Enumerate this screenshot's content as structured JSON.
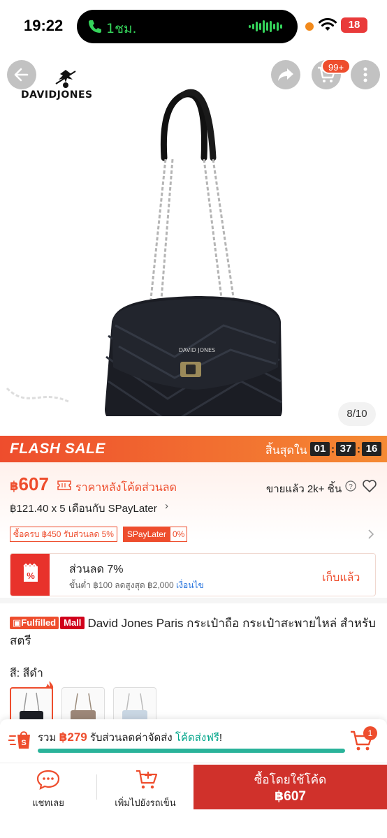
{
  "status": {
    "time": "19:22",
    "call_label": "1ชม.",
    "battery": "18"
  },
  "product_image": {
    "cart_count": "99+",
    "brand_name": "DAVIDJONES",
    "bag_logo": "DAVID JONES",
    "page_counter": "8/10"
  },
  "flash_sale": {
    "title": "FLASH SALE",
    "ends_in": "สิ้นสุดใน",
    "hours": "01",
    "minutes": "37",
    "seconds": "16"
  },
  "price": {
    "currency": "฿",
    "amount": "607",
    "after_code": "ราคาหลังโค้ดส่วนลด",
    "sold": "ขายแล้ว 2k+ ชิ้น",
    "installment": "฿121.40 x 5 เดือนกับ SPayLater",
    "installment_chevron": "›"
  },
  "promos": {
    "tag1": "ซื้อครบ ฿450 รับส่วนลด 5%",
    "tag2_left": "SPayLater",
    "tag2_right": "0%"
  },
  "voucher": {
    "title": "ส่วนลด 7%",
    "desc": "ขั้นต่ำ ฿100 ลดสูงสุด ฿2,000 ",
    "cond": "เงื่อนไข",
    "collect": "เก็บแล้ว"
  },
  "title": {
    "badge_fulfilled": "Fulfilled",
    "badge_mall": "Mall",
    "text": "David Jones Paris กระเป๋าถือ กระเป๋าสะพายไหล่ สำหรับสตรี"
  },
  "variants": {
    "label": "สี: สีดำ"
  },
  "shipping": {
    "prefix": "รวม ",
    "total": "฿279",
    "middle": " รับส่วนลดค่าจัดส่ง ",
    "free": "โค้ดส่งฟรี",
    "suffix": "!",
    "cart_count": "1"
  },
  "actions": {
    "chat": "แชทเลย",
    "add_to_cart": "เพิ่มไปยังรถเข็น",
    "buy_label": "ซื้อโดยใช้โค้ด",
    "buy_price": "฿607"
  },
  "colors": {
    "accent": "#ee4d2d",
    "buy": "#d0312b",
    "free_shipping": "#00a58a"
  }
}
